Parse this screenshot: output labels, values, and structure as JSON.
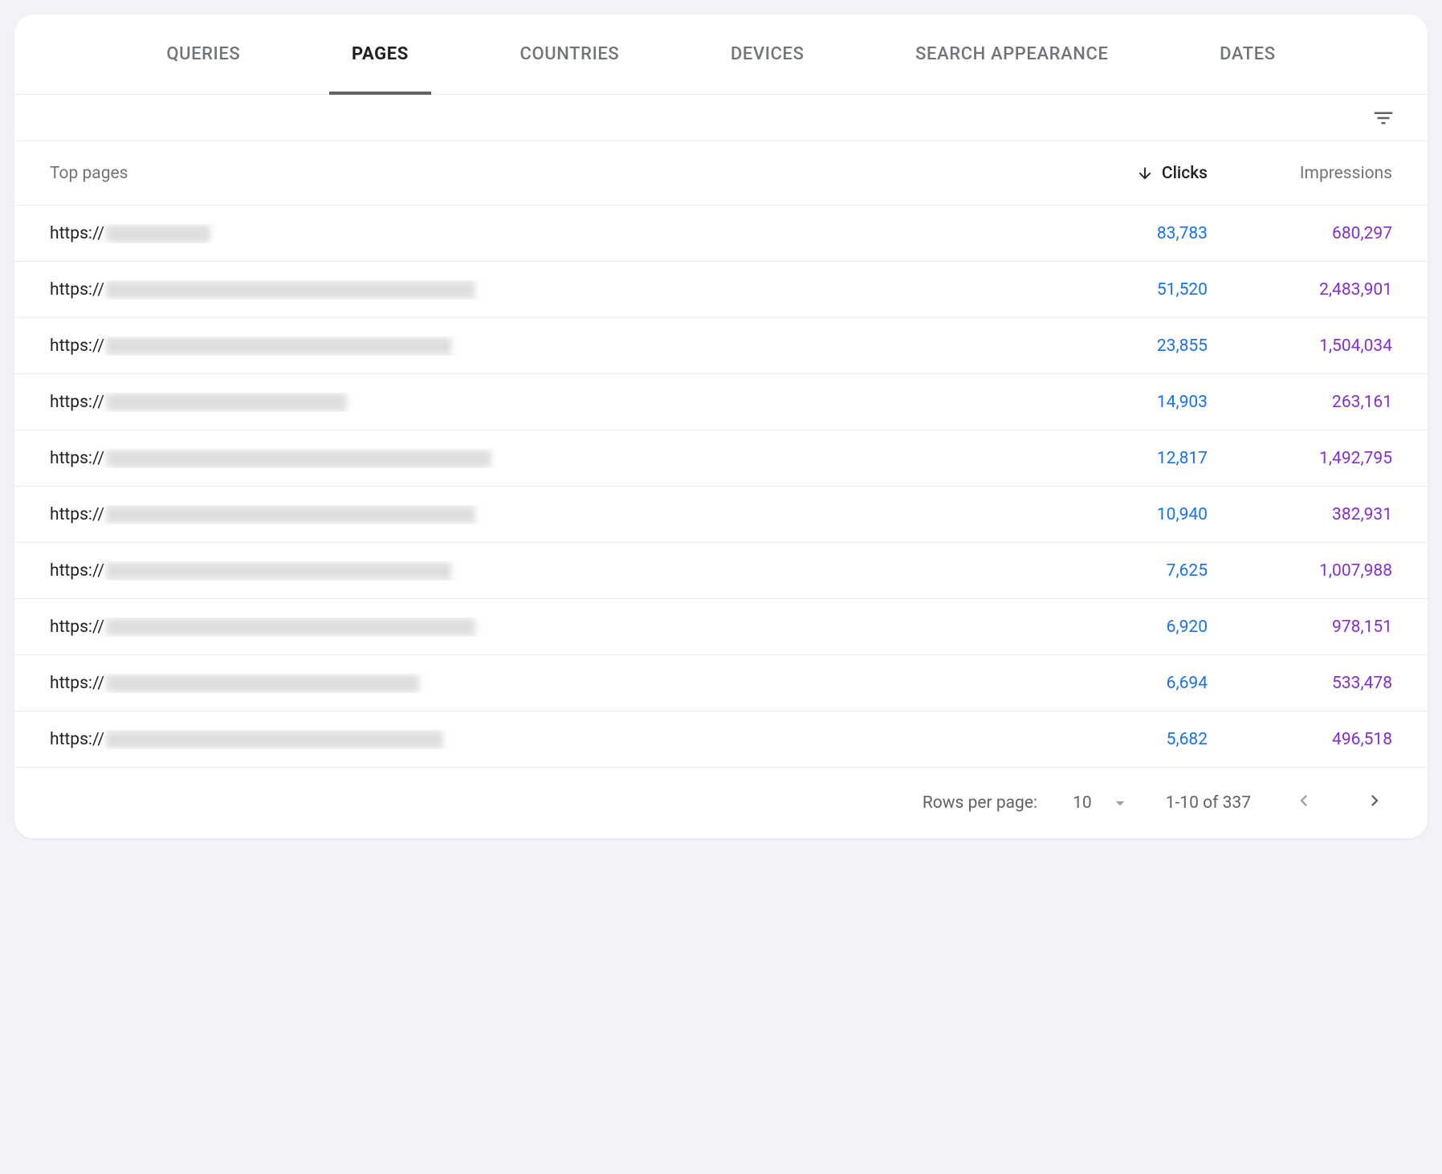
{
  "tabs": [
    {
      "label": "QUERIES",
      "active": false
    },
    {
      "label": "PAGES",
      "active": true
    },
    {
      "label": "COUNTRIES",
      "active": false
    },
    {
      "label": "DEVICES",
      "active": false
    },
    {
      "label": "SEARCH APPEARANCE",
      "active": false
    },
    {
      "label": "DATES",
      "active": false
    }
  ],
  "columns": {
    "page_header": "Top pages",
    "clicks_header": "Clicks",
    "impressions_header": "Impressions",
    "sort_column": "clicks",
    "sort_direction": "desc"
  },
  "rows": [
    {
      "url_prefix": "https://",
      "clicks": "83,783",
      "impressions": "680,297"
    },
    {
      "url_prefix": "https://",
      "clicks": "51,520",
      "impressions": "2,483,901"
    },
    {
      "url_prefix": "https://",
      "clicks": "23,855",
      "impressions": "1,504,034"
    },
    {
      "url_prefix": "https://",
      "clicks": "14,903",
      "impressions": "263,161"
    },
    {
      "url_prefix": "https://",
      "clicks": "12,817",
      "impressions": "1,492,795"
    },
    {
      "url_prefix": "https://",
      "clicks": "10,940",
      "impressions": "382,931"
    },
    {
      "url_prefix": "https://",
      "clicks": "7,625",
      "impressions": "1,007,988"
    },
    {
      "url_prefix": "https://",
      "clicks": "6,920",
      "impressions": "978,151"
    },
    {
      "url_prefix": "https://",
      "clicks": "6,694",
      "impressions": "533,478"
    },
    {
      "url_prefix": "https://",
      "clicks": "5,682",
      "impressions": "496,518"
    }
  ],
  "blur_widths": [
    130,
    460,
    430,
    300,
    480,
    460,
    430,
    460,
    390,
    420
  ],
  "pagination": {
    "rows_per_page_label": "Rows per page:",
    "rows_per_page_value": "10",
    "range_label": "1-10 of 337",
    "prev_enabled": false,
    "next_enabled": true
  },
  "icons": {
    "filter": "filter-list-icon",
    "sort_arrow": "arrow-downward-icon",
    "dropdown": "arrow-drop-down-icon",
    "prev": "chevron-left-icon",
    "next": "chevron-right-icon"
  }
}
